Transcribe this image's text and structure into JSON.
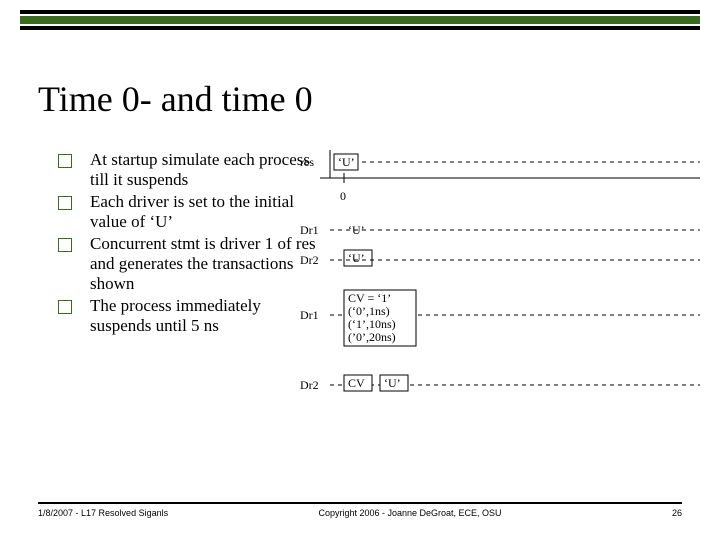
{
  "title": "Time 0- and time 0",
  "bullets": [
    "At startup simulate each process till it suspends",
    "Each driver is set to the initial value of ‘U’",
    "Concurrent stmt is driver 1 of res and generates the transactions shown",
    "The process immediately suspends until 5 ns"
  ],
  "diagram": {
    "res_label": "res",
    "u_label": "‘U’",
    "zero_label": "0",
    "dr1_label_a": "Dr1",
    "dr1_value_a": "‘U’",
    "dr2_label_a": "Dr2",
    "dr2_value_a": "‘U’",
    "dr1_label_b": "Dr1",
    "dr1_lines": [
      "CV = ‘1’",
      "(‘0’,1ns)",
      "(‘1’,10ns)",
      "(’0’,20ns)"
    ],
    "dr2_label_b": "Dr2",
    "dr2_cv": "CV",
    "dr2_val": "‘U’"
  },
  "footer": {
    "left": "1/8/2007 - L17 Resolved Siganls",
    "center": "Copyright 2006 - Joanne DeGroat, ECE, OSU",
    "right": "26"
  }
}
